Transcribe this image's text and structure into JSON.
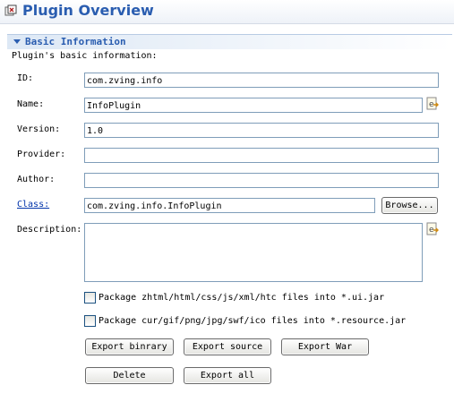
{
  "header": {
    "title": "Plugin Overview",
    "icon": "plugin-icon"
  },
  "section": {
    "title": "Basic Information",
    "description": "Plugin's basic information:"
  },
  "fields": {
    "id": {
      "label": "ID:",
      "value": "com.zving.info"
    },
    "name": {
      "label": "Name:",
      "value": "InfoPlugin"
    },
    "version": {
      "label": "Version:",
      "value": "1.0"
    },
    "provider": {
      "label": "Provider:",
      "value": ""
    },
    "author": {
      "label": "Author:",
      "value": ""
    },
    "class": {
      "label": "Class:",
      "value": "com.zving.info.InfoPlugin"
    },
    "description": {
      "label": "Description:",
      "value": ""
    }
  },
  "browse_label": "Browse...",
  "checkboxes": {
    "ui_jar": {
      "label": "Package zhtml/html/css/js/xml/htc files into *.ui.jar",
      "checked": false
    },
    "resource_jar": {
      "label": "Package cur/gif/png/jpg/swf/ico files into *.resource.jar",
      "checked": false
    }
  },
  "buttons": {
    "export_binary": "Export binrary",
    "export_source": "Export source",
    "export_war": "Export War",
    "delete": "Delete",
    "export_all": "Export all"
  },
  "colors": {
    "title": "#2a5db0",
    "link": "#0033aa",
    "field_border": "#7f9db9"
  }
}
